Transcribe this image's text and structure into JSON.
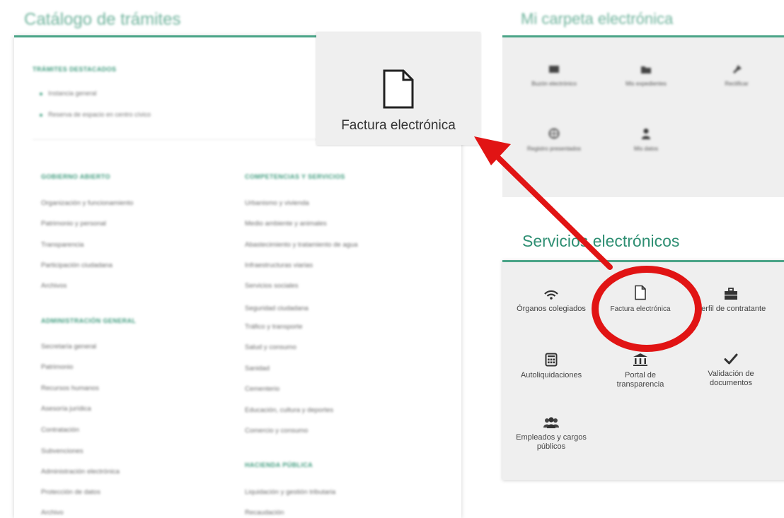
{
  "catalog": {
    "title": "Catálogo de trámites",
    "featured": {
      "heading": "Trámites destacados",
      "items": [
        "Instancia general",
        "Reserva de espacio en centro cívico"
      ]
    },
    "col1": {
      "sections": [
        {
          "heading": "Gobierno abierto",
          "items": [
            "Organización y funcionamiento",
            "Patrimonio y personal",
            "Transparencia",
            "Participación ciudadana",
            "Archivos"
          ]
        },
        {
          "heading": "Administración general",
          "items": [
            "Secretaría general",
            "Patrimonio",
            "Recursos humanos",
            "Asesoría jurídica",
            "Contratación",
            "Subvenciones",
            "Administración electrónica",
            "Protección de datos",
            "Archivo"
          ]
        }
      ]
    },
    "col2": {
      "sections": [
        {
          "heading": "Competencias y servicios",
          "items": [
            "Urbanismo y vivienda",
            "Medio ambiente y animales",
            "Abastecimiento y tratamiento de agua",
            "Infraestructuras viarias",
            "Servicios sociales",
            "Seguridad ciudadana",
            "Tráfico y transporte",
            "Salud y consumo",
            "Sanidad",
            "Cementerio",
            "Educación, cultura y deportes",
            "Comercio y consumo"
          ]
        },
        {
          "heading": "Hacienda pública",
          "items": [
            "Liquidación y gestión tributaria",
            "Recaudación"
          ]
        }
      ]
    }
  },
  "zoom_callout": {
    "label": "Factura electrónica",
    "icon": "document-icon"
  },
  "folder": {
    "title": "Mi carpeta electrónica",
    "items": [
      {
        "label": "Buzón electrónico",
        "icon": "inbox-icon"
      },
      {
        "label": "Mis expedientes",
        "icon": "folder-icon"
      },
      {
        "label": "Rectificar",
        "icon": "pin-icon"
      },
      {
        "label": "Registro presentados",
        "icon": "globe-icon"
      },
      {
        "label": "Mis datos",
        "icon": "user-icon"
      }
    ]
  },
  "services": {
    "title": "Servicios electrónicos",
    "items": [
      {
        "label": "Órganos colegiados",
        "icon": "wireless-icon"
      },
      {
        "label": "Factura electrónica",
        "icon": "document-icon"
      },
      {
        "label": "Perfil de contratante",
        "icon": "briefcase-icon"
      },
      {
        "label": "Autoliquidaciones",
        "icon": "calculator-icon"
      },
      {
        "label": "Portal de transparencia",
        "icon": "institution-icon"
      },
      {
        "label": "Validación de documentos",
        "icon": "checkmark-icon"
      },
      {
        "label": "Empleados y cargos públicos",
        "icon": "people-icon"
      }
    ]
  },
  "colors": {
    "accent": "#4aa487",
    "annotation": "#e11414",
    "title_green": "#2f8f73"
  }
}
